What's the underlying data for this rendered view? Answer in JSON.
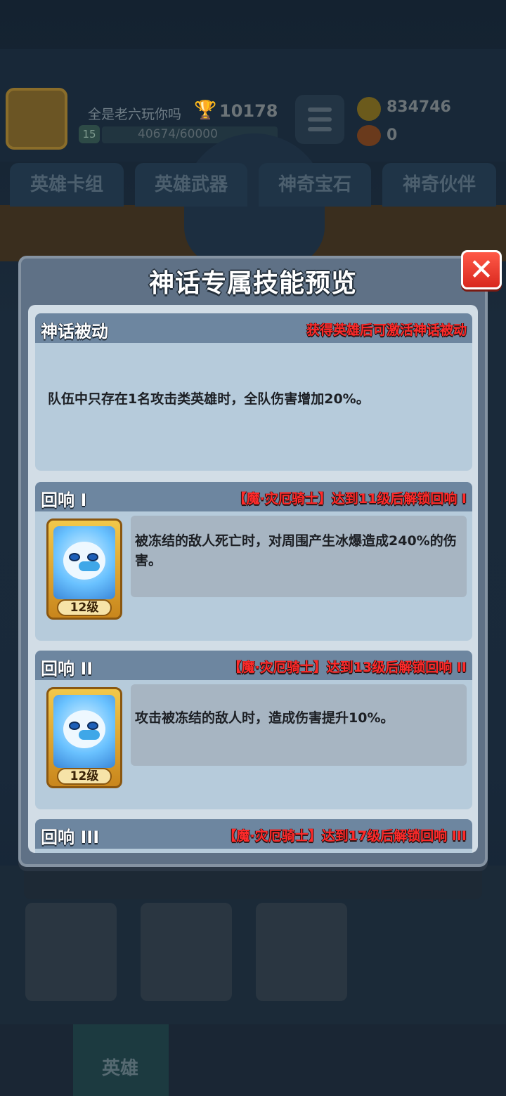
{
  "background": {
    "player_name": "全是老六玩你吗",
    "player_level": "15",
    "trophies": "10178",
    "xp": "40674/60000",
    "coins": "834746",
    "gems": "0",
    "tabs": [
      "英雄卡组",
      "英雄武器",
      "神奇宝石",
      "神奇伙伴"
    ],
    "nav_active": "英雄"
  },
  "modal": {
    "title": "神话专属技能预览",
    "close_icon": "close-x-icon",
    "passive": {
      "name": "神话被动",
      "note": "获得英雄后可激活神话被动",
      "description": "队伍中只存在1名攻击类英雄时，全队伤害增加20%。"
    },
    "echoes": [
      {
        "name": "回响 I",
        "note": "【魔·灾厄骑士】达到11级后解锁回响 I",
        "level_label": "12级",
        "description": "被冻结的敌人死亡时，对周围产生冰爆造成240%的伤害。"
      },
      {
        "name": "回响 II",
        "note": "【魔·灾厄骑士】达到13级后解锁回响 II",
        "level_label": "12级",
        "description": "攻击被冻结的敌人时，造成伤害提升10%。"
      },
      {
        "name": "回响 III",
        "note": "【魔·灾厄骑士】达到17级后解锁回响 III"
      }
    ]
  }
}
